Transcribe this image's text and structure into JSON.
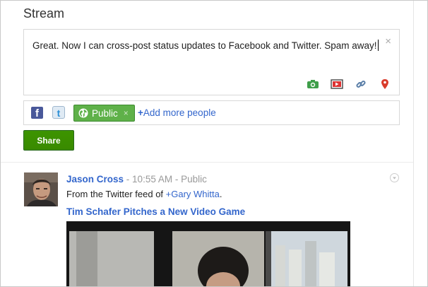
{
  "page": {
    "title": "Stream"
  },
  "compose": {
    "text": "Great. Now I can cross-post status updates to Facebook and Twitter. Spam away!",
    "close_glyph": "×",
    "tools": [
      "camera-icon",
      "video-icon",
      "link-icon",
      "location-pin-icon"
    ]
  },
  "share_bar": {
    "facebook_glyph": "f",
    "twitter_glyph": "t",
    "audience_chip": "Public",
    "chip_remove_glyph": "×",
    "add_more_prefix": "+",
    "add_more": "Add more people"
  },
  "share_button": "Share",
  "post": {
    "author": "Jason Cross",
    "sep1": " - ",
    "time": "10:55 AM",
    "sep2": " - ",
    "visibility": "Public",
    "body_prefix": "From the Twitter feed of ",
    "mention": "+Gary Whitta",
    "body_suffix": ".",
    "link_title": "Tim Schafer Pitches a New Video Game"
  },
  "colors": {
    "link": "#3366cc",
    "share_green": "#3d9400",
    "chip_green": "#5fb149",
    "facebook_blue": "#49589a"
  }
}
